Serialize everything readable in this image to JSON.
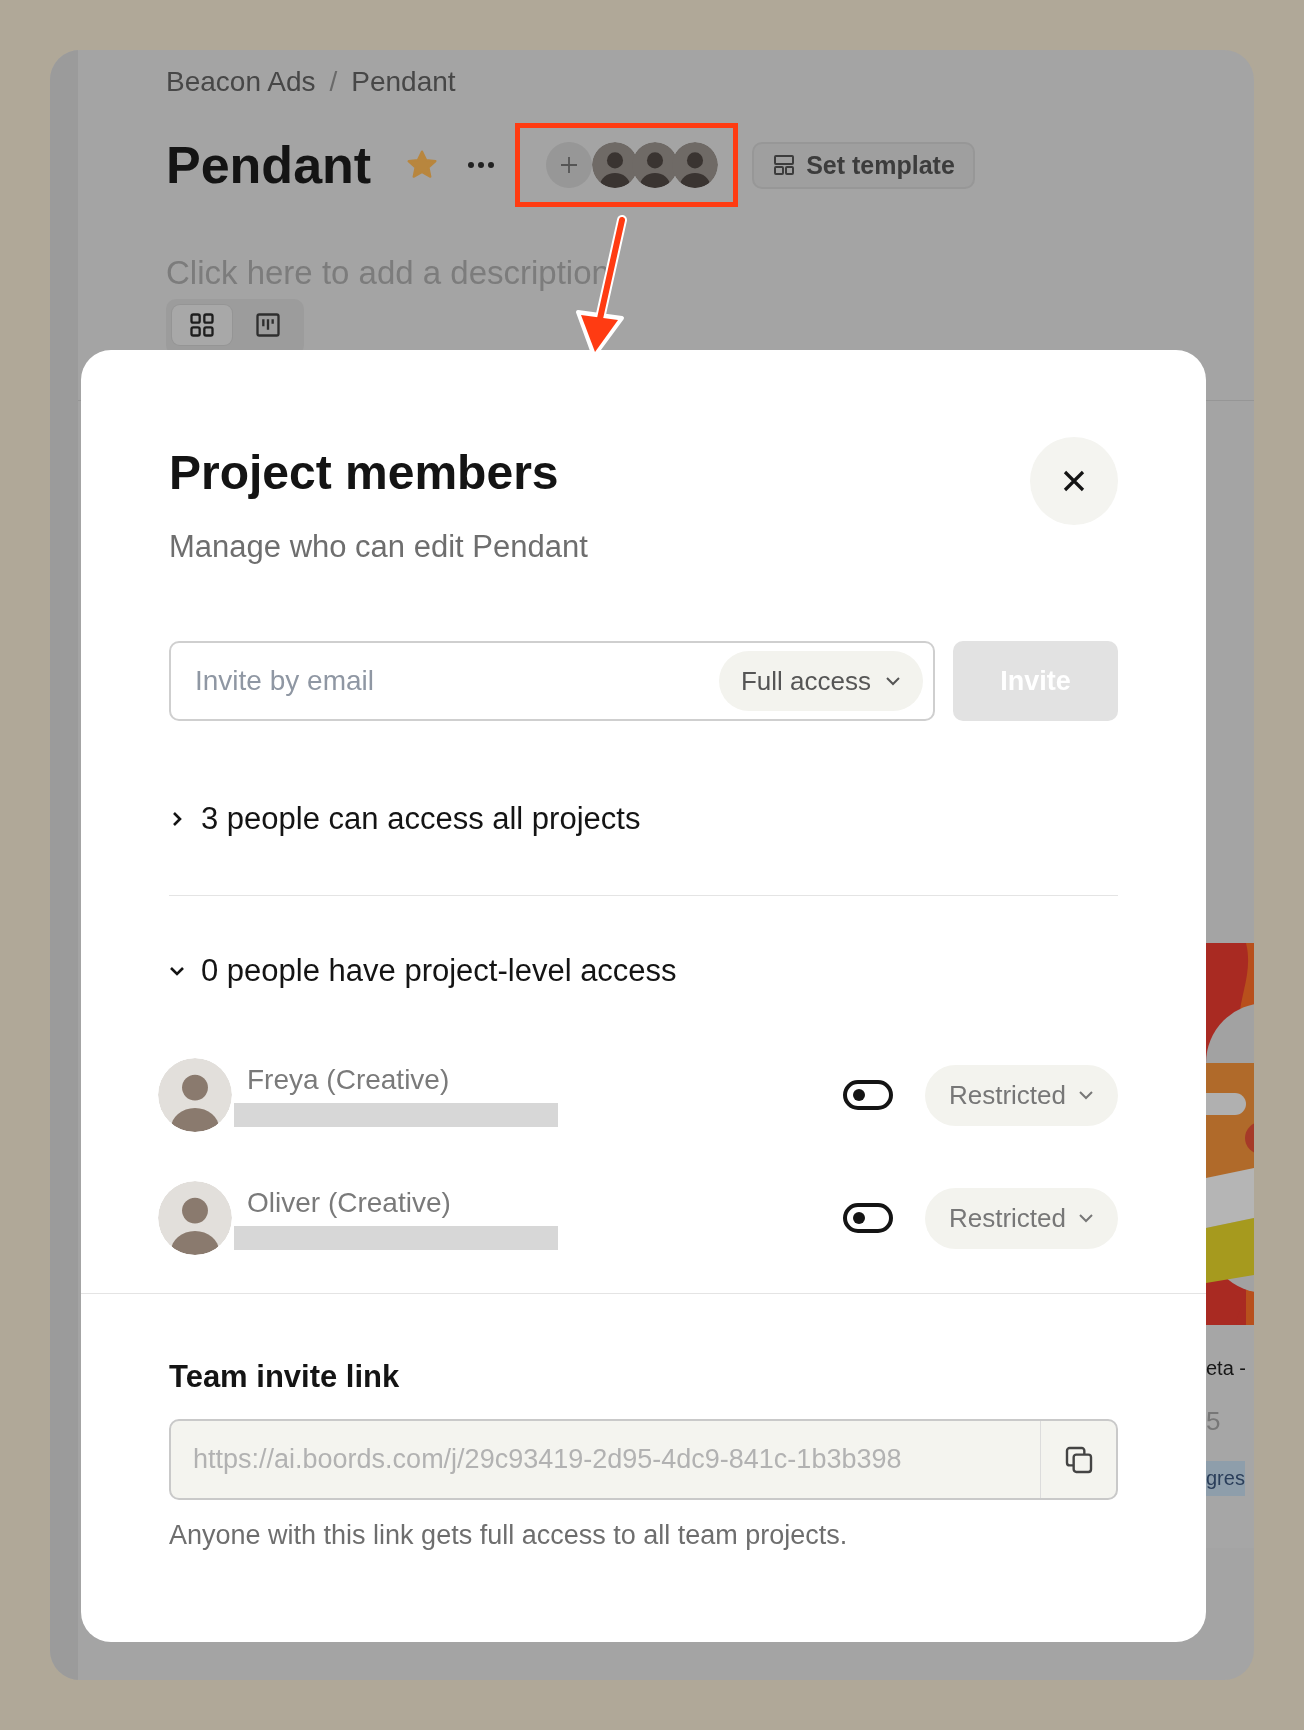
{
  "breadcrumb": {
    "items": [
      "Beacon Ads",
      "Pendant"
    ],
    "separator": "/"
  },
  "project": {
    "title": "Pendant",
    "starred": true,
    "description_placeholder": "Click here to add a description"
  },
  "member_avatars": [
    {
      "kind": "add"
    },
    {
      "kind": "picture"
    },
    {
      "kind": "picture"
    },
    {
      "kind": "picture"
    }
  ],
  "set_template_button": "Set template",
  "view_toggle": [
    {
      "kind": "grid",
      "selected": true
    },
    {
      "kind": "board",
      "selected": false
    }
  ],
  "background_card": {
    "title": "eta -",
    "meta": "5",
    "status": "gres"
  },
  "modal": {
    "title": "Project members",
    "subtitle": "Manage who can edit Pendant",
    "invite": {
      "placeholder": "Invite by email",
      "access": "Full access",
      "button": "Invite",
      "disabled": true
    },
    "sections": [
      {
        "label": "3 people can access all projects",
        "expanded": false
      },
      {
        "label": "0 people have project-level access",
        "expanded": true,
        "members": [
          {
            "name": "Freya (Creative)",
            "enabled": false,
            "access": "Restricted"
          },
          {
            "name": "Oliver (Creative)",
            "enabled": false,
            "access": "Restricted"
          }
        ]
      }
    ],
    "invite_link": {
      "title": "Team invite link",
      "url": "https://ai.boords.com/j/29c93419-2d95-4dc9-841c-1b3b398",
      "note": "Anyone with this link gets full access to all team projects."
    }
  }
}
